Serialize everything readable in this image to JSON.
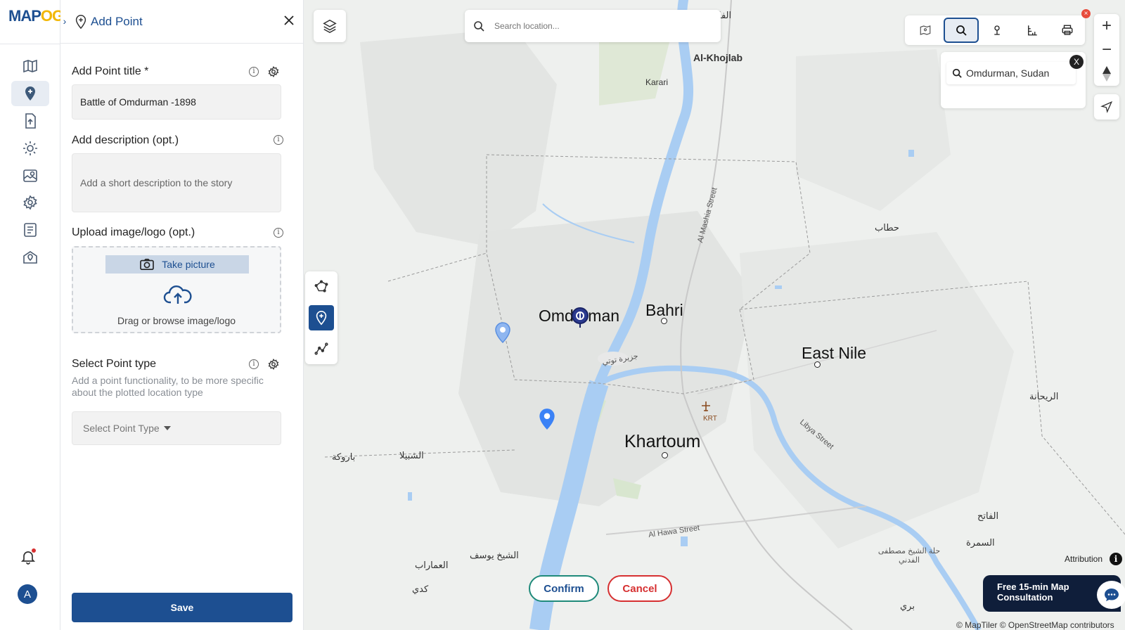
{
  "app": {
    "logo_text_a": "MAP",
    "logo_text_b": "OG"
  },
  "rail": {
    "items": [
      {
        "name": "map-icon"
      },
      {
        "name": "add-point-icon",
        "active": true
      },
      {
        "name": "upload-file-icon"
      },
      {
        "name": "settings-sun-icon"
      },
      {
        "name": "map-layers-icon"
      },
      {
        "name": "gear-icon"
      },
      {
        "name": "report-icon"
      },
      {
        "name": "map-pin-icon"
      }
    ],
    "avatar_initial": "A"
  },
  "panel": {
    "title": "Add Point",
    "title_field_label": "Add Point title *",
    "title_value": "Battle of Omdurman -1898",
    "description_label": "Add description (opt.)",
    "description_placeholder": "Add a short description to the story",
    "upload_label": "Upload image/logo (opt.)",
    "take_picture": "Take picture",
    "upload_hint": "Drag or browse image/logo",
    "point_type_label": "Select Point type",
    "point_type_help": "Add a point functionality, to be more specific about the plotted location type",
    "point_type_placeholder": "Select Point Type",
    "save_label": "Save"
  },
  "map": {
    "search_placeholder": "Search location...",
    "search_result": "Omdurman, Sudan",
    "labels": {
      "omdurman": "Omdurman",
      "bahri": "Bahri",
      "khartoum": "Khartoum",
      "east_nile": "East Nile",
      "al_khojlab": "Al-Khojlab",
      "karari": "Karari",
      "krt": "KRT",
      "al_hawa_street": "Al Hawa Street",
      "libya_street": "Libya Street",
      "al_mashia_street": "Al Mashia Street",
      "ar_fas": "الفا",
      "ar_hattab": "حطاب",
      "ar_rayhana": "الريحانة",
      "ar_baroka": "باروكة",
      "ar_shabila": "الشبيلا",
      "ar_shaykh_yusuf": "الشيخ يوسف",
      "ar_amarat": "العماراب",
      "ar_kadi": "كدي",
      "ar_fatih": "الفاتح",
      "ar_samra": "السمرة",
      "ar_hillat": "حلة الشيخ مصطفى الفدني",
      "ar_bari": "بري",
      "ar_jazeera": "جزيرة توتي"
    },
    "confirm_label": "Confirm",
    "cancel_label": "Cancel",
    "consult_line1": "Free 15-min Map",
    "consult_line2": "Consultation",
    "attribution": "Attribution",
    "copyright": "© MapTiler © OpenStreetMap contributors",
    "colors": {
      "water": "#a9cdf3",
      "land": "#eef0ee",
      "urban": "#e2e4e2",
      "accent": "#1d4f91",
      "marker": "#3b82f6"
    }
  }
}
